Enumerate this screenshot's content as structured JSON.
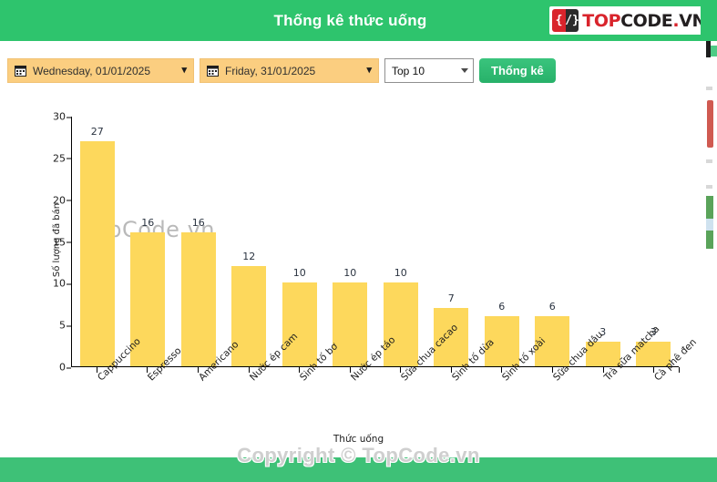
{
  "header": {
    "title": "Thống kê thức uống",
    "logo": {
      "mark_left": "{",
      "mark_right": "/}",
      "top": "TOP",
      "code": "CODE",
      "dot": ".",
      "vn": "VN"
    },
    "bg_color": "#2ec46d"
  },
  "toolbar": {
    "start_date": {
      "icon": "calendar-icon",
      "value": "Wednesday, 01/01/2025",
      "chevron": "⌄"
    },
    "end_date": {
      "icon": "calendar-icon",
      "value": "Friday, 31/01/2025",
      "chevron": "⌄"
    },
    "top_select": {
      "value": "Top 10",
      "options": [
        "Top 10"
      ]
    },
    "submit_label": "Thống kê",
    "accent_color": "#27b169",
    "date_bg_color": "#fbce80"
  },
  "watermarks": {
    "chart": "TopCode.vn",
    "footer": "Copyright © TopCode.vn"
  },
  "chart_data": {
    "type": "bar",
    "title": "",
    "xlabel": "Thức uống",
    "ylabel": "Số lượng đã bán",
    "ylim": [
      0,
      30
    ],
    "yticks": [
      0,
      5,
      10,
      15,
      20,
      25,
      30
    ],
    "grid": false,
    "legend": false,
    "bar_color": "#fdd85c",
    "categories": [
      "Cappuccino",
      "Espresso",
      "Americano",
      "Nước ép cam",
      "Sinh tố bơ",
      "Nước ép táo",
      "Sữa chua cacao",
      "Sinh tố dừa",
      "Sinh tố xoài",
      "Sữa chua dâu",
      "Trà sữa matcha",
      "Cà phê đen"
    ],
    "values": [
      27,
      16,
      16,
      12,
      10,
      10,
      10,
      7,
      6,
      6,
      3,
      3
    ]
  }
}
